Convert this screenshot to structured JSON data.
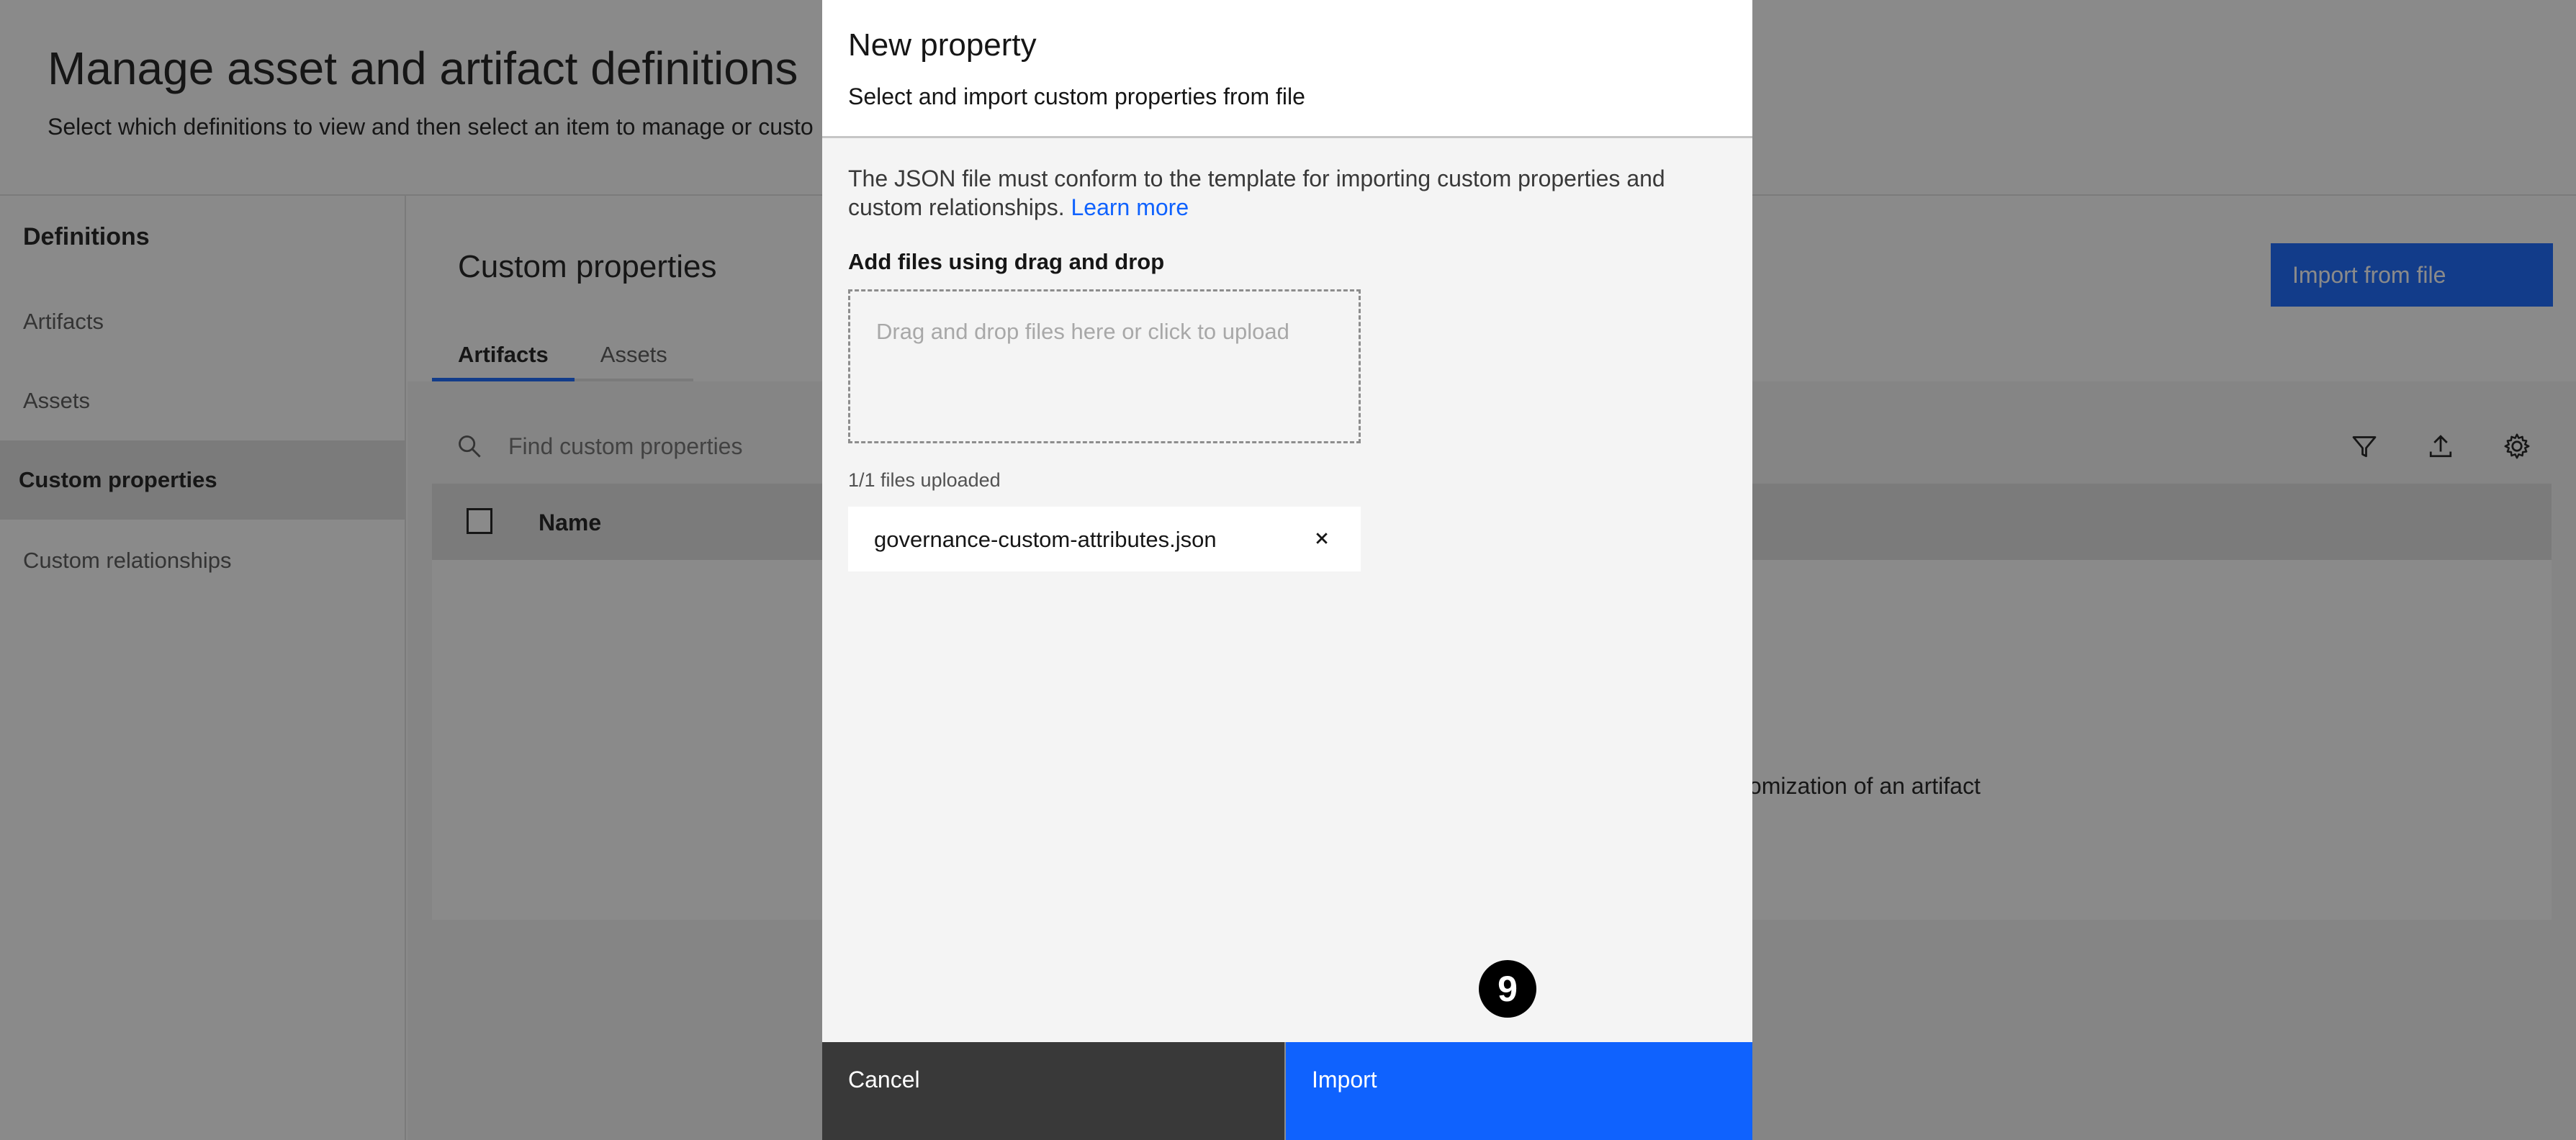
{
  "page": {
    "title": "Manage asset and artifact definitions",
    "subtitle": "Select which definitions to view and then select an item to manage or custo"
  },
  "sidebar": {
    "heading": "Definitions",
    "items": [
      {
        "label": "Artifacts"
      },
      {
        "label": "Assets"
      },
      {
        "label": "Custom properties",
        "active": true
      },
      {
        "label": "Custom relationships"
      }
    ]
  },
  "content": {
    "title": "Custom properties",
    "tabs": [
      {
        "label": "Artifacts",
        "active": true
      },
      {
        "label": "Assets"
      }
    ],
    "import_button": "Import from file",
    "search_placeholder": "Find custom properties",
    "toolbar_icons": [
      "filter-icon",
      "upload-icon",
      "settings-icon"
    ],
    "table": {
      "columns": [
        "Name"
      ]
    },
    "empty_text": "tomization of an artifact"
  },
  "modal": {
    "title": "New property",
    "subtitle": "Select and import custom properties from file",
    "description": "The JSON file must conform to the template for importing custom properties and custom relationships.",
    "learn_more": "Learn more",
    "dnd_label": "Add files using drag and drop",
    "dropzone_text": "Drag and drop files here or click to upload",
    "upload_count": "1/1 files uploaded",
    "file_name": "governance-custom-attributes.json",
    "step_badge": "9",
    "cancel_label": "Cancel",
    "import_label": "Import"
  },
  "colors": {
    "primary": "#0f62fe",
    "overlay": "rgba(22,22,22,0.5)",
    "secondary_button": "#393939"
  }
}
